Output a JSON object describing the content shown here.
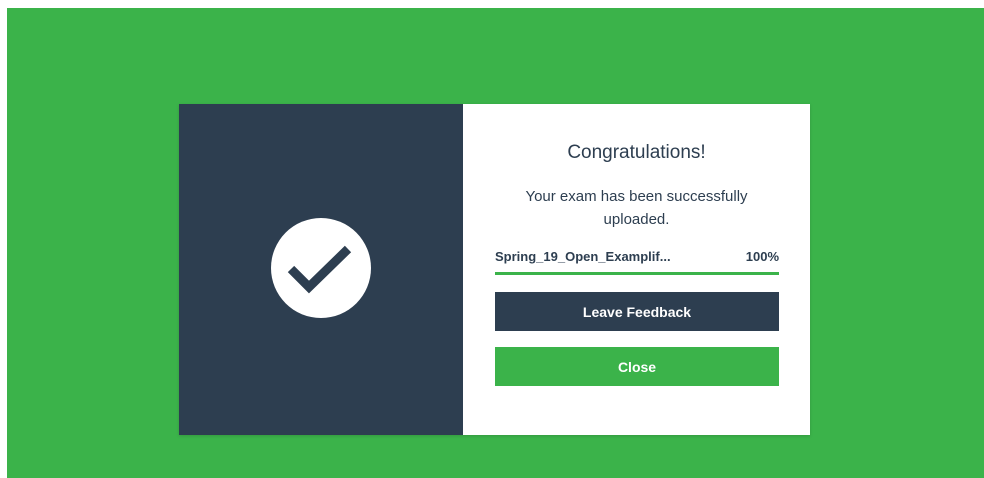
{
  "dialog": {
    "title": "Congratulations!",
    "message": "Your exam has been successfully uploaded.",
    "status_icon": "checkmark-icon",
    "upload": {
      "file_name": "Spring_19_Open_Examplif...",
      "percent_label": "100%",
      "progress": 1.0
    },
    "buttons": {
      "feedback_label": "Leave Feedback",
      "close_label": "Close"
    }
  },
  "colors": {
    "backdrop": "#3bb34a",
    "panel_dark": "#2d3e50",
    "accent_green": "#3bb34a",
    "text_dark": "#2d3e50",
    "panel_light": "#ffffff"
  }
}
